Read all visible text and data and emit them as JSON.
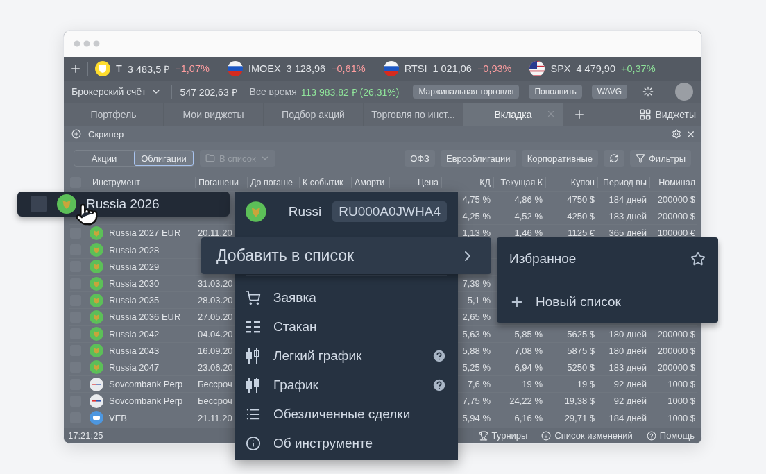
{
  "ticker_bar": {
    "items": [
      {
        "kind": "brand",
        "symbol": "Т",
        "price": "3 483,5 ₽",
        "change": "−1,07%",
        "color": "#ff9ea0"
      },
      {
        "kind": "flag_ru",
        "symbol": "IMOEX",
        "price": "3 128,96",
        "change": "−0,61%",
        "color": "#ff9ea0"
      },
      {
        "kind": "flag_ru",
        "symbol": "RTSI",
        "price": "1 021,06",
        "change": "−0,93%",
        "color": "#ff9ea0"
      },
      {
        "kind": "flag_us",
        "symbol": "SPX",
        "price": "4 479,90",
        "change": "+0,37%",
        "color": "#8fe39a"
      }
    ]
  },
  "account_bar": {
    "account": "Брокерский счёт",
    "balance": "547 202,63 ₽",
    "period_label": "Все время",
    "profit": "113 983,82 ₽ (26,31%)",
    "buttons": [
      "Маржинальная торговля",
      "Пополнить",
      "WAVG"
    ]
  },
  "tabs": [
    {
      "label": "Портфель",
      "selected": false,
      "closable": false
    },
    {
      "label": "Мои виджеты",
      "selected": false,
      "closable": false
    },
    {
      "label": "Подбор акций",
      "selected": false,
      "closable": false
    },
    {
      "label": "Торговля по инст...",
      "selected": false,
      "closable": false
    },
    {
      "label": "Вкладка",
      "selected": true,
      "closable": true
    }
  ],
  "widgets_button": "Виджеты",
  "screener": {
    "title": "Скринер"
  },
  "filters": {
    "segments": [
      {
        "label": "Акции",
        "selected": false
      },
      {
        "label": "Облигации",
        "selected": true
      }
    ],
    "list_dropdown": {
      "label": "В список",
      "disabled": true
    },
    "categories": [
      "ОФЗ",
      "Еврооблигации",
      "Корпоративные"
    ],
    "filters_button": "Фильтры"
  },
  "table": {
    "select_all_checked": false,
    "columns": [
      "Инструмент",
      "Погашени",
      "До погаше",
      "К событик",
      "Аморти",
      "Цена",
      "КД",
      "Текущая К",
      "Купон",
      "Период вы",
      "Номинал"
    ],
    "rows": [
      {
        "cells": [
          null,
          null,
          null,
          null,
          null,
          null,
          "4,75 %",
          "4,86 %",
          "4750 $",
          "184 дней",
          "200000 $"
        ]
      },
      {
        "cells": [
          null,
          null,
          null,
          null,
          null,
          null,
          "4,25 %",
          "4,52 %",
          "4250 $",
          "183 дней",
          "200000 $"
        ]
      },
      {
        "kind": "emblem",
        "checked": false,
        "cells": [
          "Russia 2027 EUR",
          "20.11.20",
          null,
          null,
          null,
          null,
          "1,13 %",
          "1,46 %",
          "1125 €",
          "365 дней",
          "100000 €"
        ]
      },
      {
        "kind": "emblem",
        "checked": false,
        "cells": [
          "Russia 2028",
          null,
          null,
          null,
          null,
          null,
          null,
          null,
          null,
          null,
          null
        ]
      },
      {
        "kind": "emblem",
        "checked": false,
        "cells": [
          "Russia 2029",
          null,
          null,
          null,
          null,
          null,
          null,
          null,
          null,
          null,
          null
        ]
      },
      {
        "kind": "emblem",
        "checked": false,
        "cells": [
          "Russia 2030",
          "31.03.20",
          null,
          null,
          null,
          null,
          "7,39 %",
          null,
          null,
          null,
          null
        ]
      },
      {
        "kind": "emblem",
        "checked": false,
        "cells": [
          "Russia 2035",
          "28.03.20",
          null,
          null,
          null,
          null,
          "5,1 %",
          null,
          null,
          null,
          null
        ]
      },
      {
        "kind": "emblem",
        "checked": false,
        "cells": [
          "Russia 2036 EUR",
          "27.05.20",
          null,
          null,
          null,
          null,
          "2,65 %",
          null,
          null,
          null,
          null
        ]
      },
      {
        "kind": "emblem",
        "checked": false,
        "cells": [
          "Russia 2042",
          "04.04.20",
          null,
          null,
          null,
          null,
          "5,63 %",
          "5,85 %",
          "5625 $",
          "180 дней",
          "200000 $"
        ]
      },
      {
        "kind": "emblem",
        "checked": false,
        "cells": [
          "Russia 2043",
          "16.09.20",
          null,
          null,
          null,
          null,
          "5,88 %",
          "7,08 %",
          "5875 $",
          "180 дней",
          "200000 $"
        ]
      },
      {
        "kind": "emblem",
        "checked": false,
        "cells": [
          "Russia 2047",
          "23.06.20",
          null,
          null,
          null,
          null,
          "5,25 %",
          "6,94 %",
          "5250 $",
          "183 дней",
          "200000 $"
        ]
      },
      {
        "kind": "sovcom",
        "checked": false,
        "cells": [
          "Sovcombank Perp",
          "Бессроч",
          null,
          null,
          null,
          null,
          "7,6 %",
          "19 %",
          "19 $",
          "92 дней",
          "1000 $"
        ]
      },
      {
        "kind": "sovcom",
        "checked": false,
        "cells": [
          "Sovcombank Perp",
          "Бессроч",
          null,
          null,
          null,
          null,
          "7,75 %",
          "24,22 %",
          "19,38 $",
          "92 дней",
          "1000 $"
        ]
      },
      {
        "kind": "veb",
        "checked": false,
        "cells": [
          "VEB",
          "21.11.20",
          null,
          null,
          null,
          null,
          "5,94 %",
          "6,16 %",
          "29,71 $",
          "184 дней",
          "1000 $"
        ]
      }
    ]
  },
  "status_bar": {
    "time": "17:21:25",
    "links": [
      {
        "label": "Турниры",
        "kind": "trophy"
      },
      {
        "label": "Список изменений",
        "kind": "info"
      },
      {
        "label": "Помощь",
        "kind": "help"
      }
    ]
  },
  "dragged_row": {
    "name": "Russia 2026",
    "kind": "emblem",
    "checked": false
  },
  "context_menu": {
    "title": "Russi",
    "code": "RU000A0JWHA4",
    "add_to_list": "Добавить в список",
    "items": [
      {
        "label": "Заявка",
        "kind": "cart",
        "help": false
      },
      {
        "label": "Стакан",
        "kind": "book",
        "help": false
      },
      {
        "label": "Легкий график",
        "kind": "candles_light",
        "help": true
      },
      {
        "label": "График",
        "kind": "candles",
        "help": true
      },
      {
        "label": "Обезличенные сделки",
        "kind": "list",
        "help": false
      },
      {
        "label": "Об инструменте",
        "kind": "info",
        "help": false
      }
    ]
  },
  "submenu": {
    "items": [
      {
        "label": "Избранное",
        "kind": "star"
      },
      {
        "label": "Новый список",
        "kind": "plus"
      }
    ]
  }
}
